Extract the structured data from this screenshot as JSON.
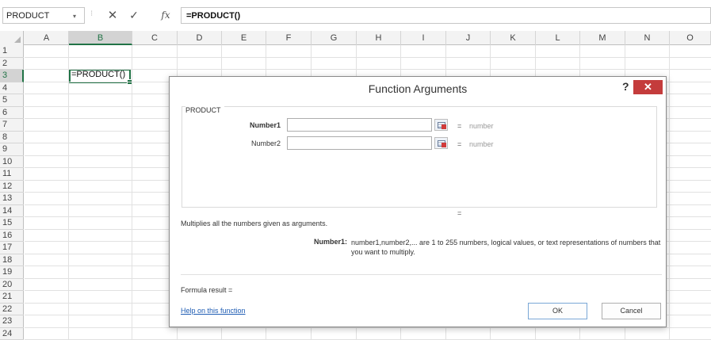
{
  "formula_bar": {
    "name_box": "PRODUCT",
    "name_box_arrow": "▾",
    "separator": "⁝",
    "cancel_glyph": "✕",
    "enter_glyph": "✓",
    "fx_glyph": "fx",
    "formula": "=PRODUCT()"
  },
  "grid": {
    "columns": [
      "A",
      "B",
      "C",
      "D",
      "E",
      "F",
      "G",
      "H",
      "I",
      "J",
      "K",
      "L",
      "M",
      "N",
      "O"
    ],
    "rows": [
      "1",
      "2",
      "3",
      "4",
      "5",
      "6",
      "7",
      "8",
      "9",
      "10",
      "11",
      "12",
      "13",
      "14",
      "15",
      "16",
      "17",
      "18",
      "19",
      "20",
      "21",
      "22",
      "23",
      "24"
    ],
    "selected_column": "B",
    "selected_row": "3",
    "active_cell_value": "=PRODUCT()"
  },
  "dialog": {
    "title": "Function Arguments",
    "help_glyph": "?",
    "close_glyph": "✕",
    "function_name": "PRODUCT",
    "args": [
      {
        "label": "Number1",
        "value": "",
        "eq": "=",
        "type": "number"
      },
      {
        "label": "Number2",
        "value": "",
        "eq": "=",
        "type": "number"
      }
    ],
    "result_eq": "=",
    "description": "Multiplies all the numbers given as arguments.",
    "arg_detail_label": "Number1:",
    "arg_detail_text": "number1,number2,... are 1 to 255 numbers, logical values, or text representations of numbers that you want to multiply.",
    "formula_result": "Formula result =",
    "help_link": "Help on this function",
    "ok_label": "OK",
    "cancel_label": "Cancel"
  },
  "colors": {
    "accent_green": "#217346",
    "close_red": "#c43c3c",
    "link_blue": "#1e5cb3"
  }
}
